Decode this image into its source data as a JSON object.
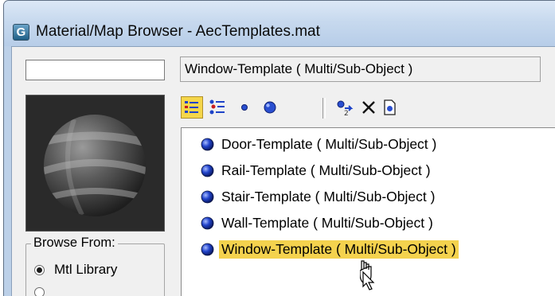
{
  "window": {
    "title": "Material/Map Browser - AecTemplates.mat",
    "app_icon_glyph": "G",
    "titlebar_color": "#c7d9ee"
  },
  "name_field": {
    "value": ""
  },
  "current_material": {
    "label": "Window-Template  ( Multi/Sub-Object )"
  },
  "toolbar": {
    "buttons": [
      {
        "icon": "view-list-icon",
        "active": true
      },
      {
        "icon": "view-list-icons-icon",
        "active": false
      },
      {
        "icon": "small-icons-icon",
        "active": false
      },
      {
        "icon": "large-icons-icon",
        "active": false
      },
      {
        "icon": "update-scene-materials-icon",
        "active": false
      },
      {
        "icon": "delete-from-library-icon",
        "active": false
      },
      {
        "icon": "clear-material-library-icon",
        "active": false
      }
    ]
  },
  "materials": {
    "items": [
      {
        "label": "Door-Template  ( Multi/Sub-Object )",
        "selected": false
      },
      {
        "label": "Rail-Template  ( Multi/Sub-Object )",
        "selected": false
      },
      {
        "label": "Stair-Template  ( Multi/Sub-Object )",
        "selected": false
      },
      {
        "label": "Wall-Template  ( Multi/Sub-Object )",
        "selected": false
      },
      {
        "label": "Window-Template  ( Multi/Sub-Object )",
        "selected": true
      }
    ],
    "selection_color": "#f4d24e"
  },
  "browse_from": {
    "legend": "Browse From:",
    "options": [
      {
        "label": "Mtl Library",
        "checked": true
      }
    ]
  }
}
